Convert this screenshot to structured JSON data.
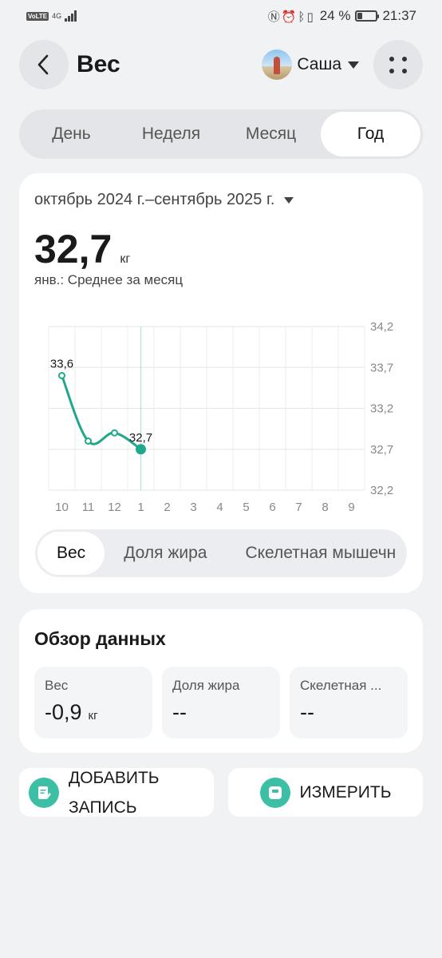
{
  "status": {
    "network_badge": "VoLTE",
    "network_type": "4G",
    "icons": [
      "nfc-icon",
      "alarm-icon",
      "bluetooth-icon",
      "vibrate-icon"
    ],
    "battery": "24 %",
    "battery_level": 0.24,
    "time": "21:37"
  },
  "header": {
    "title": "Вес",
    "user_name": "Саша"
  },
  "period_tabs": [
    {
      "label": "День",
      "active": false
    },
    {
      "label": "Неделя",
      "active": false
    },
    {
      "label": "Месяц",
      "active": false
    },
    {
      "label": "Год",
      "active": true
    }
  ],
  "summary": {
    "range": "октябрь 2024 г.–сентябрь 2025 г.",
    "value": "32,7",
    "unit": "кг",
    "caption": "янв.: Среднее за месяц"
  },
  "chart_data": {
    "type": "line",
    "categories": [
      "10",
      "11",
      "12",
      "1",
      "2",
      "3",
      "4",
      "5",
      "6",
      "7",
      "8",
      "9"
    ],
    "series": [
      {
        "values": [
          33.6,
          32.8,
          32.9,
          32.7,
          null,
          null,
          null,
          null,
          null,
          null,
          null,
          null
        ]
      }
    ],
    "ylim": [
      32.2,
      34.2
    ],
    "yticks": [
      "34,2",
      "33,7",
      "33,2",
      "32,7",
      "32,2"
    ],
    "data_labels": [
      {
        "index": 0,
        "text": "33,6"
      },
      {
        "index": 3,
        "text": "32,7"
      }
    ],
    "selected_index": 3,
    "grid": true,
    "line_color": "#20a88c"
  },
  "metric_tabs": [
    {
      "label": "Вес",
      "active": true
    },
    {
      "label": "Доля жира",
      "active": false
    },
    {
      "label": "Скелетная мышечн",
      "active": false
    }
  ],
  "overview": {
    "title": "Обзор данных",
    "tiles": [
      {
        "label": "Вес",
        "value": "-0,9",
        "unit": "кг"
      },
      {
        "label": "Доля жира",
        "value": "--",
        "unit": ""
      },
      {
        "label": "Скелетная ...",
        "value": "--",
        "unit": ""
      }
    ]
  },
  "actions": {
    "add_line1": "ДОБАВИТЬ",
    "add_line2": "ЗАПИСЬ",
    "measure": "ИЗМЕРИТЬ"
  },
  "colors": {
    "accent": "#20a88c",
    "icon_bg": "#3dbfa6"
  }
}
